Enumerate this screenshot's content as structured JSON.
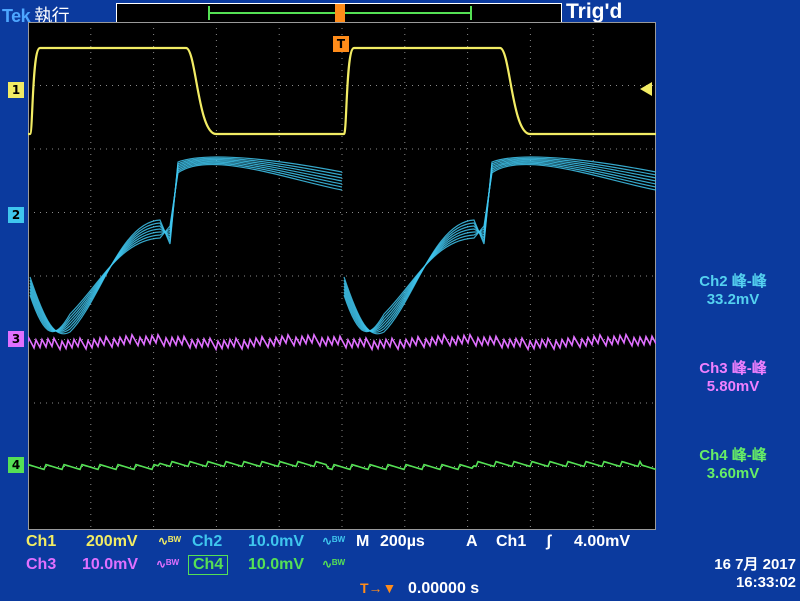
{
  "header": {
    "brand": "Tek",
    "run_state": "執行",
    "trigger_status": "Trig'd"
  },
  "channels": [
    {
      "id": "1",
      "color": "#f2ec64"
    },
    {
      "id": "2",
      "color": "#3fc6ee"
    },
    {
      "id": "3",
      "color": "#e070ff"
    },
    {
      "id": "4",
      "color": "#55e055"
    }
  ],
  "measurements": [
    {
      "title": "Ch2 峰-峰",
      "value": "33.2mV"
    },
    {
      "title": "Ch3 峰-峰",
      "value": "5.80mV"
    },
    {
      "title": "Ch4 峰-峰",
      "value": "3.60mV"
    }
  ],
  "settings": {
    "ch1_label": "Ch1",
    "ch1_scale": "200mV",
    "ch2_label": "Ch2",
    "ch2_scale": "10.0mV",
    "ch3_label": "Ch3",
    "ch3_scale": "10.0mV",
    "ch4_label": "Ch4",
    "ch4_scale": "10.0mV",
    "coupling_glyph": "∿ᴮᵂ",
    "timebase_label": "M",
    "timebase": "200µs",
    "trigger_label": "A",
    "trigger_source": "Ch1",
    "trigger_slope": "ʃ",
    "trigger_level": "4.00mV",
    "trigger_position_label": "T→▼",
    "trigger_position": "0.00000 s"
  },
  "date": {
    "date": "16 7月  2017",
    "time": "16:33:02"
  },
  "markers": {
    "trigger_t": "T"
  }
}
